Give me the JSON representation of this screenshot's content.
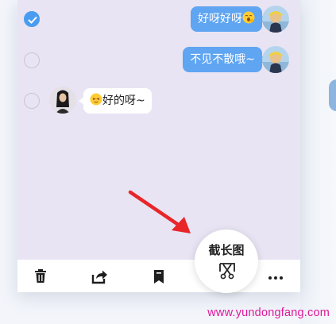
{
  "messages": [
    {
      "side": "right",
      "text": "好呀好呀",
      "emoji": "yawning-face-emoji",
      "selected": true
    },
    {
      "side": "right",
      "text": "不见不散哦~",
      "selected": false
    },
    {
      "side": "left",
      "text": "好的呀~",
      "emoji": "squinting-face-emoji",
      "selected": false
    }
  ],
  "toolbar": {
    "items": [
      {
        "name": "delete",
        "icon": "trash-icon"
      },
      {
        "name": "forward",
        "icon": "share-icon"
      },
      {
        "name": "favorite",
        "icon": "bookmark-icon"
      },
      {
        "name": "more",
        "icon": "more-icon"
      }
    ]
  },
  "screenshot_button": {
    "label": "截长图",
    "icon": "long-screenshot-icon"
  },
  "watermark": "www.yundongfang.com",
  "colors": {
    "chat_background": "#e9e4f3",
    "sent_bubble": "#5fa5f2",
    "received_bubble": "#ffffff",
    "check_selected": "#4a9cf0",
    "arrow": "#e8262a",
    "watermark": "#e0189a"
  }
}
